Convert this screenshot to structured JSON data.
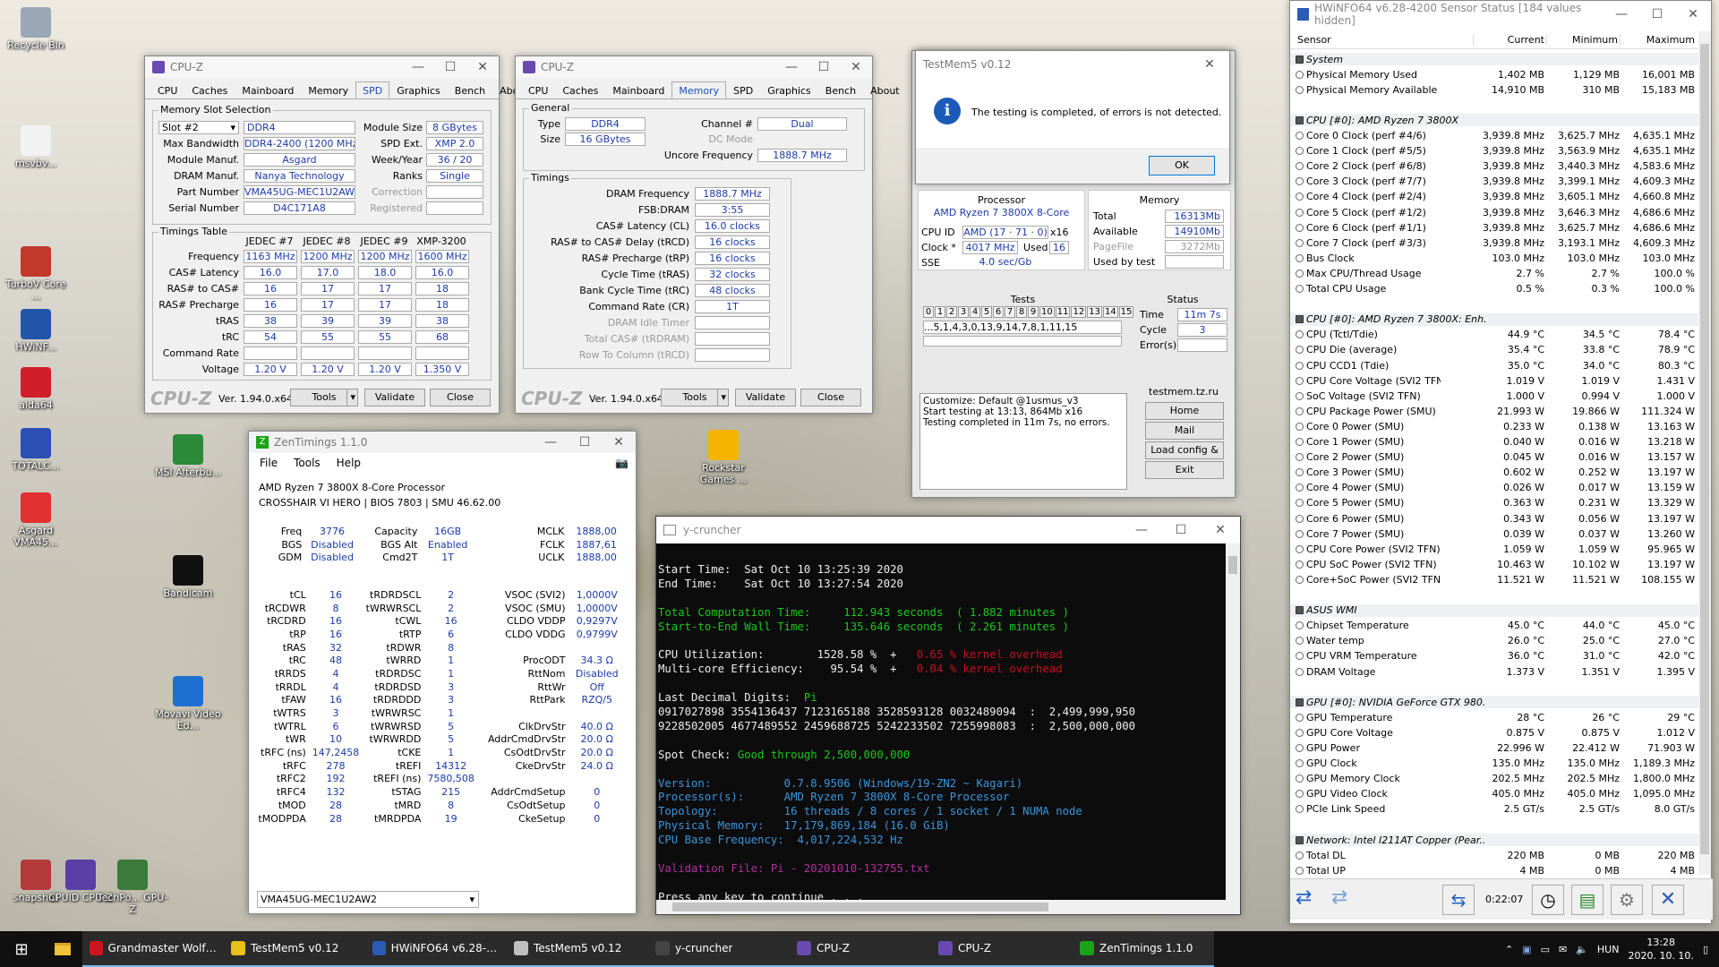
{
  "desktop_icons": [
    {
      "label": "Recycle Bin",
      "color": "#9aa7b6"
    },
    {
      "label": "msvbv...",
      "color": "#f2f2f2"
    },
    {
      "label": "TurboV Core ...",
      "color": "#c0392b"
    },
    {
      "label": "HWiNF...",
      "color": "#2255aa"
    },
    {
      "label": "aida64",
      "color": "#d01f2a"
    },
    {
      "label": "TOTALC...",
      "color": "#2a4fb5"
    },
    {
      "label": "Asgard VMA45...",
      "color": "#e03030"
    },
    {
      "label": "MSI Afterbu...",
      "color": "#2a8a3a"
    },
    {
      "label": "Bandicam",
      "color": "#111111"
    },
    {
      "label": "Movavi Video Ed...",
      "color": "#1f6fd1"
    },
    {
      "label": "snapshot",
      "color": "#b33a3a"
    },
    {
      "label": "CPUID CPU-Z",
      "color": "#5a3fa6"
    },
    {
      "label": "TechPo... GPU-Z",
      "color": "#3a7a3a"
    },
    {
      "label": "Rockstar Games ...",
      "color": "#f4b400"
    }
  ],
  "cpuz1": {
    "title": "CPU-Z",
    "tabs": [
      "CPU",
      "Caches",
      "Mainboard",
      "Memory",
      "SPD",
      "Graphics",
      "Bench",
      "About"
    ],
    "active_tab": "SPD",
    "slot_group": "Memory Slot Selection",
    "slot": "Slot #2",
    "rows": [
      {
        "l": "Max Bandwidth",
        "v": "DDR4-2400 (1200 MHz)"
      },
      {
        "l": "Module Manuf.",
        "v": "Asgard"
      },
      {
        "l": "DRAM Manuf.",
        "v": "Nanya Technology"
      },
      {
        "l": "Part Number",
        "v": "VMA45UG-MEC1U2AW2"
      },
      {
        "l": "Serial Number",
        "v": "D4C171A8"
      }
    ],
    "type": "DDR4",
    "right_rows": [
      {
        "l": "Module Size",
        "v": "8 GBytes"
      },
      {
        "l": "SPD Ext.",
        "v": "XMP 2.0"
      },
      {
        "l": "Week/Year",
        "v": "36 / 20"
      },
      {
        "l": "Ranks",
        "v": "Single"
      },
      {
        "l": "Correction",
        "v": ""
      },
      {
        "l": "Registered",
        "v": ""
      }
    ],
    "timings_group": "Timings Table",
    "cols": [
      "JEDEC #7",
      "JEDEC #8",
      "JEDEC #9",
      "XMP-3200"
    ],
    "trows": [
      {
        "l": "Frequency",
        "v": [
          "1163 MHz",
          "1200 MHz",
          "1200 MHz",
          "1600 MHz"
        ]
      },
      {
        "l": "CAS# Latency",
        "v": [
          "16.0",
          "17.0",
          "18.0",
          "16.0"
        ]
      },
      {
        "l": "RAS# to CAS#",
        "v": [
          "16",
          "17",
          "17",
          "18"
        ]
      },
      {
        "l": "RAS# Precharge",
        "v": [
          "16",
          "17",
          "17",
          "18"
        ]
      },
      {
        "l": "tRAS",
        "v": [
          "38",
          "39",
          "39",
          "38"
        ]
      },
      {
        "l": "tRC",
        "v": [
          "54",
          "55",
          "55",
          "68"
        ]
      },
      {
        "l": "Command Rate",
        "v": [
          "",
          "",
          "",
          ""
        ]
      },
      {
        "l": "Voltage",
        "v": [
          "1.20 V",
          "1.20 V",
          "1.20 V",
          "1.350 V"
        ]
      }
    ],
    "logo": "CPU-Z",
    "version": "Ver. 1.94.0.x64",
    "tools": "Tools",
    "validate": "Validate",
    "close": "Close"
  },
  "cpuz2": {
    "title": "CPU-Z",
    "tabs": [
      "CPU",
      "Caches",
      "Mainboard",
      "Memory",
      "SPD",
      "Graphics",
      "Bench",
      "About"
    ],
    "active_tab": "Memory",
    "general": "General",
    "type_l": "Type",
    "type": "DDR4",
    "size_l": "Size",
    "size": "16 GBytes",
    "channel_l": "Channel #",
    "channel": "Dual",
    "dc_l": "DC Mode",
    "dc": "",
    "unc_l": "Uncore Frequency",
    "unc": "1888.7 MHz",
    "timings": "Timings",
    "rows": [
      {
        "l": "DRAM Frequency",
        "v": "1888.7 MHz"
      },
      {
        "l": "FSB:DRAM",
        "v": "3:55"
      },
      {
        "l": "CAS# Latency (CL)",
        "v": "16.0 clocks"
      },
      {
        "l": "RAS# to CAS# Delay (tRCD)",
        "v": "16 clocks"
      },
      {
        "l": "RAS# Precharge (tRP)",
        "v": "16 clocks"
      },
      {
        "l": "Cycle Time (tRAS)",
        "v": "32 clocks"
      },
      {
        "l": "Bank Cycle Time (tRC)",
        "v": "48 clocks"
      },
      {
        "l": "Command Rate (CR)",
        "v": "1T"
      },
      {
        "l": "DRAM Idle Timer",
        "v": ""
      },
      {
        "l": "Total CAS# (tRDRAM)",
        "v": ""
      },
      {
        "l": "Row To Column (tRCD)",
        "v": ""
      }
    ],
    "logo": "CPU-Z",
    "version": "Ver. 1.94.0.x64",
    "tools": "Tools",
    "validate": "Validate",
    "close": "Close"
  },
  "testmem": {
    "title": "TestMem5 v0.12",
    "message": "The testing is completed, of errors is not detected.",
    "ok": "OK",
    "processor_h": "Processor",
    "cpu": "AMD Ryzen 7 3800X 8-Core",
    "cpuid_l": "CPU ID",
    "cpuid": "AMD  (17 · 71 · 0)",
    "cpuid_x": "x16",
    "clock_l": "Clock *",
    "clock": "4017 MHz",
    "used_l": "Used",
    "used": "16",
    "sse_l": "SSE",
    "sse": "4.0 sec/Gb",
    "memory_h": "Memory",
    "total_l": "Total",
    "total": "16313Mb",
    "avail_l": "Available",
    "avail": "14910Mb",
    "pagefile_l": "PageFile",
    "pagefile": "3272Mb",
    "usedby_l": "Used by test",
    "tests_h": "Tests",
    "tests": [
      "0",
      "1",
      "2",
      "3",
      "4",
      "5",
      "6",
      "7",
      "8",
      "9",
      "10",
      "11",
      "12",
      "13",
      "14",
      "15"
    ],
    "seq": "...5,1,4,3,0,13,9,14,7,8,1,11,15",
    "status_h": "Status",
    "time_l": "Time",
    "time": "11m 7s",
    "cycle_l": "Cycle",
    "cycle": "3",
    "err_l": "Error(s)",
    "err": "",
    "log": [
      "Customize: Default @1usmus_v3",
      "Start testing at 13:13, 864Mb x16",
      "Testing completed in 11m 7s, no errors."
    ],
    "site": "testmem.tz.ru",
    "home": "Home",
    "mail": "Mail",
    "load": "Load config & exit",
    "exit": "Exit"
  },
  "zen": {
    "title": "ZenTimings 1.1.0",
    "menu": [
      "File",
      "Tools",
      "Help"
    ],
    "cpu": "AMD Ryzen 7 3800X 8-Core Processor",
    "board": "CROSSHAIR VI HERO | BIOS 7803 | SMU 46.62.00",
    "top": [
      [
        "Freq",
        "3776",
        "Capacity",
        "16GB",
        "MCLK",
        "1888,00"
      ],
      [
        "BGS",
        "Disabled",
        "BGS Alt",
        "Enabled",
        "FCLK",
        "1887,61"
      ],
      [
        "GDM",
        "Disabled",
        "Cmd2T",
        "1T",
        "UCLK",
        "1888,00"
      ]
    ],
    "rows": [
      [
        "tCL",
        "16",
        "tRDRDSCL",
        "2",
        "VSOC (SVI2)",
        "1,0000V"
      ],
      [
        "tRCDWR",
        "8",
        "tWRWRSCL",
        "2",
        "VSOC (SMU)",
        "1,0000V"
      ],
      [
        "tRCDRD",
        "16",
        "tCWL",
        "16",
        "CLDO VDDP",
        "0,9297V"
      ],
      [
        "tRP",
        "16",
        "tRTP",
        "6",
        "CLDO VDDG",
        "0,9799V"
      ],
      [
        "tRAS",
        "32",
        "tRDWR",
        "8",
        "",
        ""
      ],
      [
        "tRC",
        "48",
        "tWRRD",
        "1",
        "ProcODT",
        "34.3 Ω"
      ],
      [
        "tRRDS",
        "4",
        "tRDRDSC",
        "1",
        "RttNom",
        "Disabled"
      ],
      [
        "tRRDL",
        "4",
        "tRDRDSD",
        "3",
        "RttWr",
        "Off"
      ],
      [
        "tFAW",
        "16",
        "tRDRDDD",
        "3",
        "RttPark",
        "RZQ/5"
      ],
      [
        "tWTRS",
        "3",
        "tWRWRSC",
        "1",
        "",
        ""
      ],
      [
        "tWTRL",
        "6",
        "tWRWRSD",
        "5",
        "ClkDrvStr",
        "40.0 Ω"
      ],
      [
        "tWR",
        "10",
        "tWRWRDD",
        "5",
        "AddrCmdDrvStr",
        "20.0 Ω"
      ],
      [
        "tRFC (ns)",
        "147,2458",
        "tCKE",
        "1",
        "CsOdtDrvStr",
        "20.0 Ω"
      ],
      [
        "tRFC",
        "278",
        "tREFI",
        "14312",
        "CkeDrvStr",
        "24.0 Ω"
      ],
      [
        "tRFC2",
        "192",
        "tREFI (ns)",
        "7580,508",
        "",
        ""
      ],
      [
        "tRFC4",
        "132",
        "tSTAG",
        "215",
        "AddrCmdSetup",
        "0"
      ],
      [
        "tMOD",
        "28",
        "tMRD",
        "8",
        "CsOdtSetup",
        "0"
      ],
      [
        "tMODPDA",
        "28",
        "tMRDPDA",
        "19",
        "CkeSetup",
        "0"
      ]
    ],
    "module": "VMA45UG-MEC1U2AW2"
  },
  "ycruncher": {
    "title": "y-cruncher",
    "start": "Start Time:  Sat Oct 10 13:25:39 2020",
    "end": "End Time:    Sat Oct 10 13:27:54 2020",
    "tct": "Total Computation Time:     112.943 seconds  ( 1.882 minutes )",
    "sew": "Start-to-End Wall Time:     135.646 seconds  ( 2.261 minutes )",
    "util_a": "CPU Utilization:        1528.58 %  +   ",
    "util_b": "0.65 % kernel overhead",
    "eff_a": "Multi-core Efficiency:    95.54 %  +   ",
    "eff_b": "0.04 % kernel overhead",
    "ldd_a": "Last Decimal Digits:  ",
    "ldd_b": "Pi",
    "d1": "0917027898 3554136437 7123165188 3528593128 0032489094  :  2,499,999,950",
    "d2": "9228502005 4677489552 2459688725 5242233502 7255998083  :  2,500,000,000",
    "spot_a": "Spot Check: ",
    "spot_b": "Good through 2,500,000,000",
    "v1": "Version:           0.7.8.9506 (Windows/19-ZN2 ~ Kagari)",
    "v2": "Processor(s):      AMD Ryzen 7 3800X 8-Core Processor",
    "v3": "Topology:          16 threads / 8 cores / 1 socket / 1 NUMA node",
    "v4": "Physical Memory:   17,179,869,184 (16.0 GiB)",
    "v5": "CPU Base Frequency:  4,017,224,532 Hz",
    "vf": "Validation File: Pi - 20201010-132755.txt",
    "press": "Press any key to continue . . ."
  },
  "hwinfo": {
    "title": "HWiNFO64 v6.28-4200 Sensor Status [184 values hidden]",
    "headers": [
      "Sensor",
      "Current",
      "Minimum",
      "Maximum"
    ],
    "rows": [
      {
        "s": 1,
        "n": "System"
      },
      {
        "n": "Physical Memory Used",
        "c": "1,402 MB",
        "mi": "1,129 MB",
        "ma": "16,001 MB"
      },
      {
        "n": "Physical Memory Available",
        "c": "14,910 MB",
        "mi": "310 MB",
        "ma": "15,183 MB"
      },
      {
        "g": 1
      },
      {
        "s": 1,
        "n": "CPU [#0]: AMD Ryzen 7 3800X"
      },
      {
        "n": "Core 0 Clock (perf #4/6)",
        "c": "3,939.8 MHz",
        "mi": "3,625.7 MHz",
        "ma": "4,635.1 MHz"
      },
      {
        "n": "Core 1 Clock (perf #5/5)",
        "c": "3,939.8 MHz",
        "mi": "3,563.9 MHz",
        "ma": "4,635.1 MHz"
      },
      {
        "n": "Core 2 Clock (perf #6/8)",
        "c": "3,939.8 MHz",
        "mi": "3,440.3 MHz",
        "ma": "4,583.6 MHz"
      },
      {
        "n": "Core 3 Clock (perf #7/7)",
        "c": "3,939.8 MHz",
        "mi": "3,399.1 MHz",
        "ma": "4,609.3 MHz"
      },
      {
        "n": "Core 4 Clock (perf #2/4)",
        "c": "3,939.8 MHz",
        "mi": "3,605.1 MHz",
        "ma": "4,660.8 MHz"
      },
      {
        "n": "Core 5 Clock (perf #1/2)",
        "c": "3,939.8 MHz",
        "mi": "3,646.3 MHz",
        "ma": "4,686.6 MHz"
      },
      {
        "n": "Core 6 Clock (perf #1/1)",
        "c": "3,939.8 MHz",
        "mi": "3,625.7 MHz",
        "ma": "4,686.6 MHz"
      },
      {
        "n": "Core 7 Clock (perf #3/3)",
        "c": "3,939.8 MHz",
        "mi": "3,193.1 MHz",
        "ma": "4,609.3 MHz"
      },
      {
        "n": "Bus Clock",
        "c": "103.0 MHz",
        "mi": "103.0 MHz",
        "ma": "103.0 MHz"
      },
      {
        "n": "Max CPU/Thread Usage",
        "c": "2.7 %",
        "mi": "2.7 %",
        "ma": "100.0 %"
      },
      {
        "n": "Total CPU Usage",
        "c": "0.5 %",
        "mi": "0.3 %",
        "ma": "100.0 %"
      },
      {
        "g": 1
      },
      {
        "s": 1,
        "n": "CPU [#0]: AMD Ryzen 7 3800X: Enh..."
      },
      {
        "n": "CPU (Tctl/Tdie)",
        "c": "44.9 °C",
        "mi": "34.5 °C",
        "ma": "78.4 °C"
      },
      {
        "n": "CPU Die (average)",
        "c": "35.4 °C",
        "mi": "33.8 °C",
        "ma": "78.9 °C"
      },
      {
        "n": "CPU CCD1 (Tdie)",
        "c": "35.0 °C",
        "mi": "34.0 °C",
        "ma": "80.3 °C"
      },
      {
        "n": "CPU Core Voltage (SVI2 TFN)",
        "c": "1.019 V",
        "mi": "1.019 V",
        "ma": "1.431 V"
      },
      {
        "n": "SoC Voltage (SVI2 TFN)",
        "c": "1.000 V",
        "mi": "0.994 V",
        "ma": "1.000 V"
      },
      {
        "n": "CPU Package Power (SMU)",
        "c": "21.993 W",
        "mi": "19.866 W",
        "ma": "111.324 W"
      },
      {
        "n": "Core 0 Power (SMU)",
        "c": "0.233 W",
        "mi": "0.138 W",
        "ma": "13.163 W"
      },
      {
        "n": "Core 1 Power (SMU)",
        "c": "0.040 W",
        "mi": "0.016 W",
        "ma": "13.218 W"
      },
      {
        "n": "Core 2 Power (SMU)",
        "c": "0.045 W",
        "mi": "0.016 W",
        "ma": "13.157 W"
      },
      {
        "n": "Core 3 Power (SMU)",
        "c": "0.602 W",
        "mi": "0.252 W",
        "ma": "13.197 W"
      },
      {
        "n": "Core 4 Power (SMU)",
        "c": "0.026 W",
        "mi": "0.017 W",
        "ma": "13.159 W"
      },
      {
        "n": "Core 5 Power (SMU)",
        "c": "0.363 W",
        "mi": "0.231 W",
        "ma": "13.329 W"
      },
      {
        "n": "Core 6 Power (SMU)",
        "c": "0.343 W",
        "mi": "0.056 W",
        "ma": "13.197 W"
      },
      {
        "n": "Core 7 Power (SMU)",
        "c": "0.039 W",
        "mi": "0.037 W",
        "ma": "13.260 W"
      },
      {
        "n": "CPU Core Power (SVI2 TFN)",
        "c": "1.059 W",
        "mi": "1.059 W",
        "ma": "95.965 W"
      },
      {
        "n": "CPU SoC Power (SVI2 TFN)",
        "c": "10.463 W",
        "mi": "10.102 W",
        "ma": "13.197 W"
      },
      {
        "n": "Core+SoC Power (SVI2 TFN)",
        "c": "11.521 W",
        "mi": "11.521 W",
        "ma": "108.155 W"
      },
      {
        "g": 1
      },
      {
        "s": 1,
        "n": "ASUS WMI"
      },
      {
        "n": "Chipset Temperature",
        "c": "45.0 °C",
        "mi": "44.0 °C",
        "ma": "45.0 °C"
      },
      {
        "n": "Water temp",
        "c": "26.0 °C",
        "mi": "25.0 °C",
        "ma": "27.0 °C"
      },
      {
        "n": "CPU VRM Temperature",
        "c": "36.0 °C",
        "mi": "31.0 °C",
        "ma": "42.0 °C"
      },
      {
        "n": "DRAM Voltage",
        "c": "1.373 V",
        "mi": "1.351 V",
        "ma": "1.395 V"
      },
      {
        "g": 1
      },
      {
        "s": 1,
        "n": "GPU [#0]: NVIDIA GeForce GTX 980..."
      },
      {
        "n": "GPU Temperature",
        "c": "28 °C",
        "mi": "26 °C",
        "ma": "29 °C"
      },
      {
        "n": "GPU Core Voltage",
        "c": "0.875 V",
        "mi": "0.875 V",
        "ma": "1.012 V"
      },
      {
        "n": "GPU Power",
        "c": "22.996 W",
        "mi": "22.412 W",
        "ma": "71.903 W"
      },
      {
        "n": "GPU Clock",
        "c": "135.0 MHz",
        "mi": "135.0 MHz",
        "ma": "1,189.3 MHz"
      },
      {
        "n": "GPU Memory Clock",
        "c": "202.5 MHz",
        "mi": "202.5 MHz",
        "ma": "1,800.0 MHz"
      },
      {
        "n": "GPU Video Clock",
        "c": "405.0 MHz",
        "mi": "405.0 MHz",
        "ma": "1,095.0 MHz"
      },
      {
        "n": "PCIe Link Speed",
        "c": "2.5 GT/s",
        "mi": "2.5 GT/s",
        "ma": "8.0 GT/s"
      },
      {
        "g": 1
      },
      {
        "s": 1,
        "n": "Network: Intel I211AT Copper (Pear..."
      },
      {
        "n": "Total DL",
        "c": "220 MB",
        "mi": "0 MB",
        "ma": "220 MB"
      },
      {
        "n": "Total UP",
        "c": "4 MB",
        "mi": "0 MB",
        "ma": "4 MB"
      }
    ],
    "elapsed": "0:22:07"
  },
  "taskbar": {
    "items": [
      {
        "label": "Grandmaster Wolf G...",
        "color": "#d0141e"
      },
      {
        "label": "TestMem5 v0.12",
        "color": "#e8c21a"
      },
      {
        "label": "HWiNFO64 v6.28-42...",
        "color": "#2a5bb5"
      },
      {
        "label": "TestMem5 v0.12",
        "color": "#c0c0c0"
      },
      {
        "label": "y-cruncher",
        "color": "#444444"
      },
      {
        "label": "CPU-Z",
        "color": "#6a4ab0"
      },
      {
        "label": "CPU-Z",
        "color": "#6a4ab0"
      },
      {
        "label": "ZenTimings 1.1.0",
        "color": "#1aa31a"
      }
    ],
    "lang": "HUN",
    "time": "13:28",
    "date": "2020. 10. 10."
  }
}
